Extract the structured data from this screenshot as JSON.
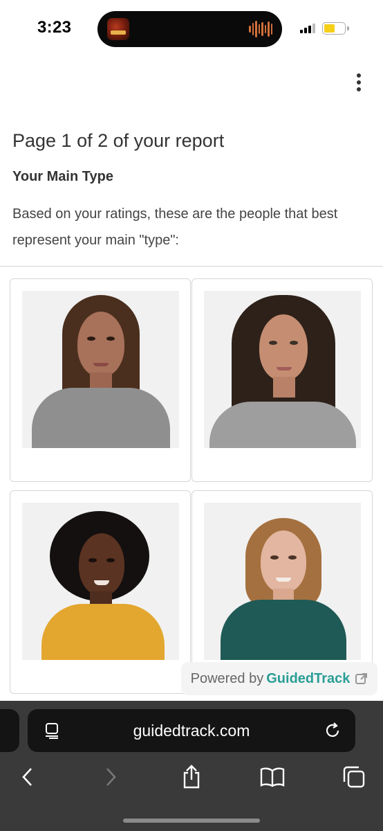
{
  "status_bar": {
    "time": "3:23",
    "now_playing_icon": "album-art-icon",
    "audio_icon": "waveform-icon",
    "signal_bars": 3,
    "battery_level": 0.55,
    "battery_color": "#f5cf1a"
  },
  "app_header": {
    "menu_icon": "more-vertical-icon"
  },
  "report": {
    "page_title": "Page 1 of 2 of your report",
    "section_title": "Your Main Type",
    "description": "Based on your ratings, these are the people that best represent your main \"type\":",
    "cards": [
      {
        "image": "portrait-photo-1"
      },
      {
        "image": "portrait-photo-2"
      },
      {
        "image": "portrait-photo-3"
      },
      {
        "image": "portrait-photo-4"
      }
    ]
  },
  "powered_by": {
    "prefix": "Powered by",
    "brand": "GuidedTrack",
    "brand_color": "#2a9d96",
    "icon": "external-link-icon"
  },
  "browser": {
    "url": "guidedtrack.com",
    "reader_icon": "page-menu-icon",
    "reload_icon": "reload-icon",
    "toolbar": [
      "back-icon",
      "forward-icon",
      "share-icon",
      "bookmarks-icon",
      "tabs-icon"
    ]
  }
}
